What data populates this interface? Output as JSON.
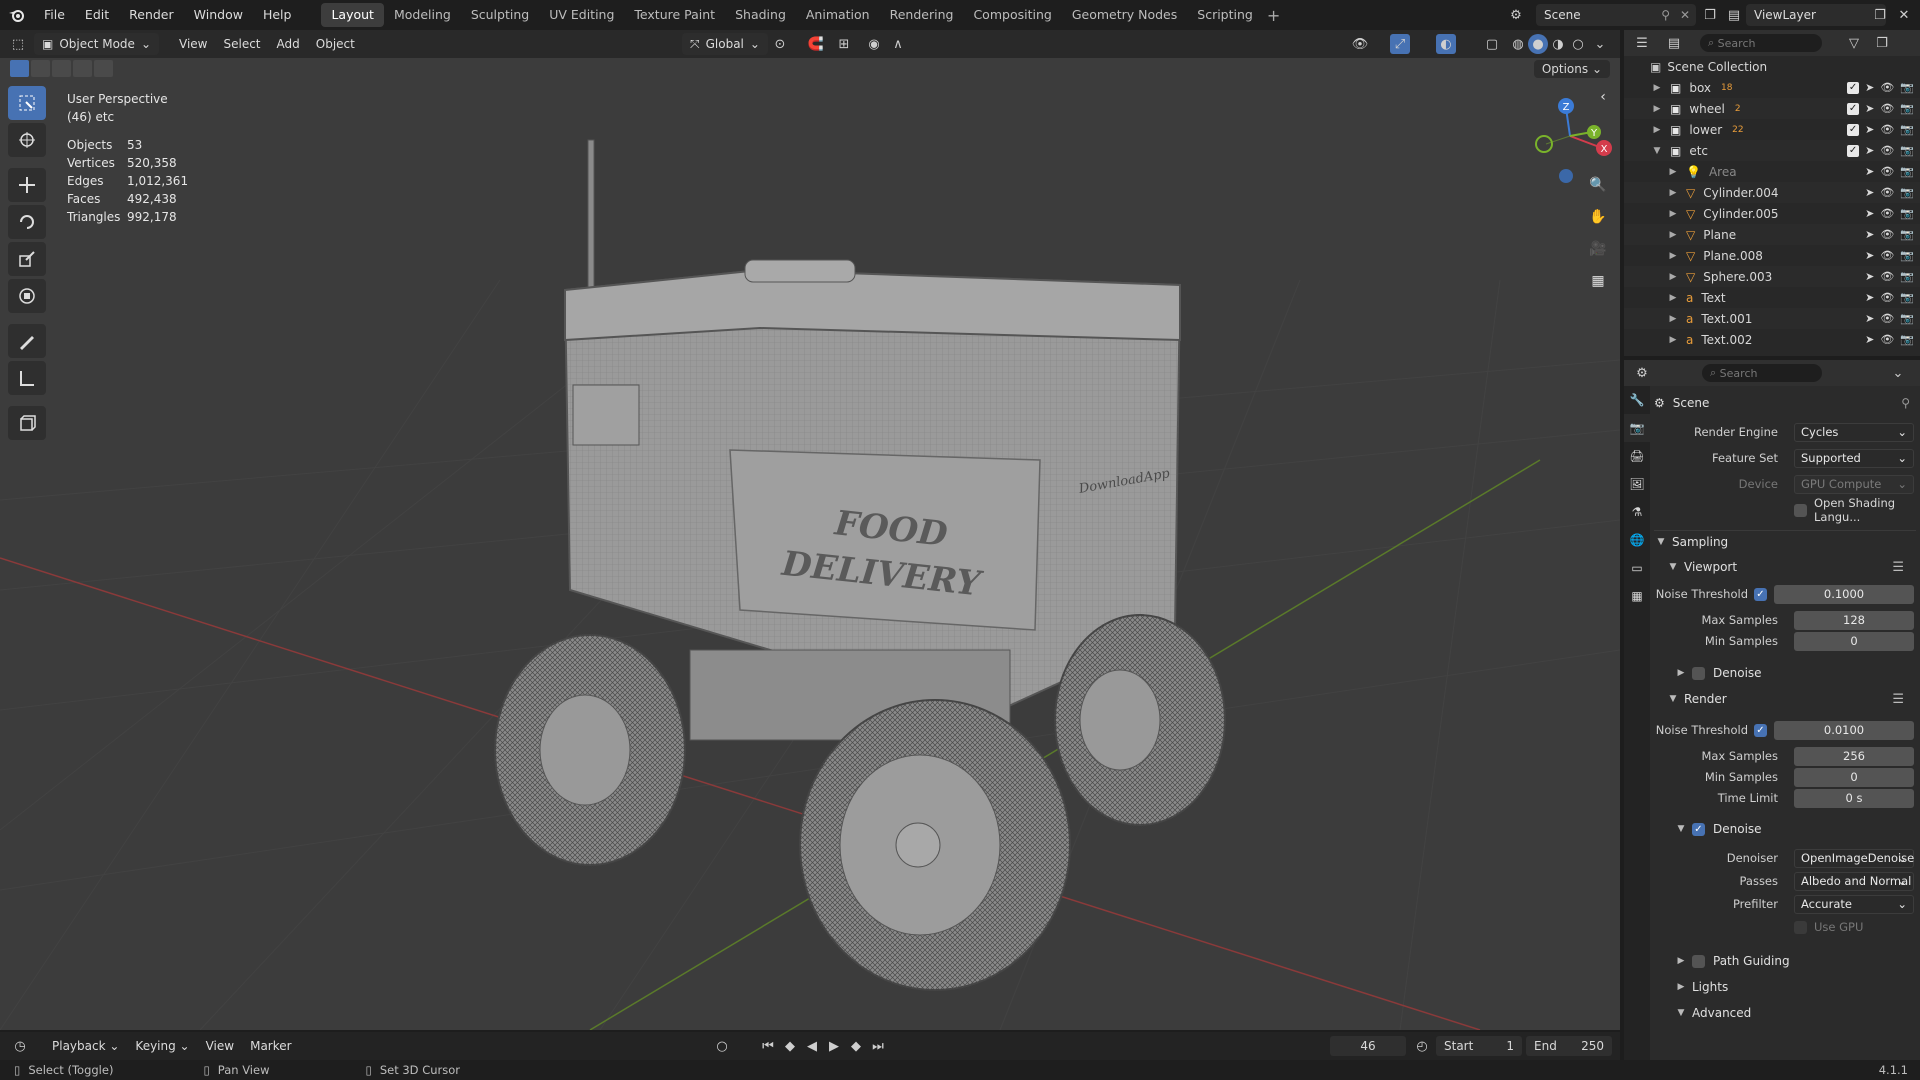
{
  "topbar": {
    "menus": [
      "File",
      "Edit",
      "Render",
      "Window",
      "Help"
    ],
    "workspaces": [
      "Layout",
      "Modeling",
      "Sculpting",
      "UV Editing",
      "Texture Paint",
      "Shading",
      "Animation",
      "Rendering",
      "Compositing",
      "Geometry Nodes",
      "Scripting"
    ],
    "active_workspace": "Layout",
    "scene": "Scene",
    "view_layer": "ViewLayer"
  },
  "viewport": {
    "mode": "Object Mode",
    "menus": [
      "View",
      "Select",
      "Add",
      "Object"
    ],
    "orientation": "Global",
    "options_label": "Options",
    "view_name": "User Perspective",
    "collection_info": "(46) etc",
    "stats": [
      {
        "label": "Objects",
        "value": "53"
      },
      {
        "label": "Vertices",
        "value": "520,358"
      },
      {
        "label": "Edges",
        "value": "1,012,361"
      },
      {
        "label": "Faces",
        "value": "492,438"
      },
      {
        "label": "Triangles",
        "value": "992,178"
      }
    ],
    "model_text": {
      "line1": "FOOD",
      "line2": "DELIVERY",
      "brand": "DownloadApp"
    },
    "gizmo_axes": {
      "x": "X",
      "y": "Y",
      "z": "Z"
    }
  },
  "timeline": {
    "menus": [
      "Playback",
      "Keying",
      "View",
      "Marker"
    ],
    "current_frame": "46",
    "start_label": "Start",
    "start": "1",
    "end_label": "End",
    "end": "250"
  },
  "statusbar": {
    "select": "Select (Toggle)",
    "pan": "Pan View",
    "cursor": "Set 3D Cursor",
    "version": "4.1.1"
  },
  "outliner": {
    "search_placeholder": "Search",
    "root": "Scene Collection",
    "rows": [
      {
        "name": "box",
        "type": "collection",
        "count": "18",
        "expanded": false
      },
      {
        "name": "wheel",
        "type": "collection",
        "count": "2",
        "expanded": false
      },
      {
        "name": "lower",
        "type": "collection",
        "count": "22",
        "expanded": false
      },
      {
        "name": "etc",
        "type": "collection",
        "count": "",
        "expanded": true
      },
      {
        "name": "Area",
        "type": "light",
        "count": "",
        "expanded": false
      },
      {
        "name": "Cylinder.004",
        "type": "mesh",
        "count": "",
        "expanded": false
      },
      {
        "name": "Cylinder.005",
        "type": "mesh",
        "count": "",
        "expanded": false
      },
      {
        "name": "Plane",
        "type": "mesh",
        "count": "",
        "expanded": false
      },
      {
        "name": "Plane.008",
        "type": "mesh",
        "count": "",
        "expanded": false
      },
      {
        "name": "Sphere.003",
        "type": "mesh",
        "count": "",
        "expanded": false
      },
      {
        "name": "Text",
        "type": "text",
        "count": "",
        "expanded": false
      },
      {
        "name": "Text.001",
        "type": "text",
        "count": "",
        "expanded": false
      },
      {
        "name": "Text.002",
        "type": "text",
        "count": "",
        "expanded": false
      }
    ]
  },
  "properties": {
    "search_placeholder": "Search",
    "context": "Scene",
    "render_engine_label": "Render Engine",
    "render_engine": "Cycles",
    "feature_set_label": "Feature Set",
    "feature_set": "Supported",
    "device_label": "Device",
    "device": "GPU Compute",
    "osl_label": "Open Shading Langu...",
    "sampling": "Sampling",
    "viewport_section": "Viewport",
    "noise_threshold_label": "Noise Threshold",
    "viewport_noise": "0.1000",
    "max_samples_label": "Max Samples",
    "viewport_max": "128",
    "min_samples_label": "Min Samples",
    "viewport_min": "0",
    "denoise_label": "Denoise",
    "render_section": "Render",
    "render_noise": "0.0100",
    "render_max": "256",
    "render_min": "0",
    "time_limit_label": "Time Limit",
    "time_limit": "0 s",
    "denoiser_label": "Denoiser",
    "denoiser": "OpenImageDenoise",
    "passes_label": "Passes",
    "passes": "Albedo and Normal",
    "prefilter_label": "Prefilter",
    "prefilter": "Accurate",
    "use_gpu_label": "Use GPU",
    "path_guiding": "Path Guiding",
    "lights": "Lights",
    "advanced": "Advanced"
  }
}
